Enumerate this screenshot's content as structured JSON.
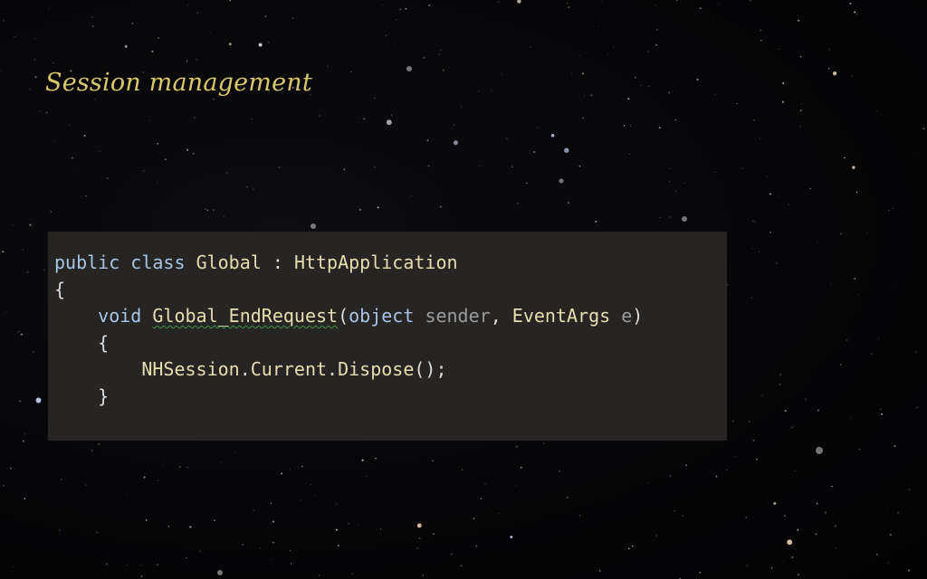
{
  "slide": {
    "title": "Session management"
  },
  "code": {
    "lines": [
      [
        {
          "text": "public",
          "kind": "kw"
        },
        {
          "text": " ",
          "kind": "pun"
        },
        {
          "text": "class",
          "kind": "kw"
        },
        {
          "text": " ",
          "kind": "pun"
        },
        {
          "text": "Global",
          "kind": "typ"
        },
        {
          "text": " : ",
          "kind": "pun"
        },
        {
          "text": "HttpApplication",
          "kind": "typ"
        }
      ],
      [
        {
          "text": "{",
          "kind": "pun"
        }
      ],
      [
        {
          "text": "    ",
          "kind": "pun"
        },
        {
          "text": "void",
          "kind": "kw"
        },
        {
          "text": " ",
          "kind": "pun"
        },
        {
          "text": "Global_EndRequest",
          "kind": "fn",
          "squiggle": true
        },
        {
          "text": "(",
          "kind": "pun"
        },
        {
          "text": "object",
          "kind": "kw"
        },
        {
          "text": " ",
          "kind": "pun"
        },
        {
          "text": "sender",
          "kind": "par"
        },
        {
          "text": ", ",
          "kind": "pun"
        },
        {
          "text": "EventArgs",
          "kind": "typ"
        },
        {
          "text": " ",
          "kind": "pun"
        },
        {
          "text": "e",
          "kind": "par"
        },
        {
          "text": ")",
          "kind": "pun"
        }
      ],
      [
        {
          "text": "    {",
          "kind": "pun"
        }
      ],
      [
        {
          "text": "        ",
          "kind": "pun"
        },
        {
          "text": "NHSession",
          "kind": "typ"
        },
        {
          "text": ".",
          "kind": "pun"
        },
        {
          "text": "Current",
          "kind": "typ"
        },
        {
          "text": ".",
          "kind": "pun"
        },
        {
          "text": "Dispose",
          "kind": "typ"
        },
        {
          "text": "();",
          "kind": "pun"
        }
      ],
      [
        {
          "text": "    }",
          "kind": "pun"
        }
      ]
    ]
  },
  "colors": {
    "title": "#d8c86a",
    "code_background": "#272523",
    "keyword": "#a8c4e6",
    "type": "#e6deae",
    "parameter": "#9b9b9b",
    "squiggle": "#3b9a4a"
  }
}
